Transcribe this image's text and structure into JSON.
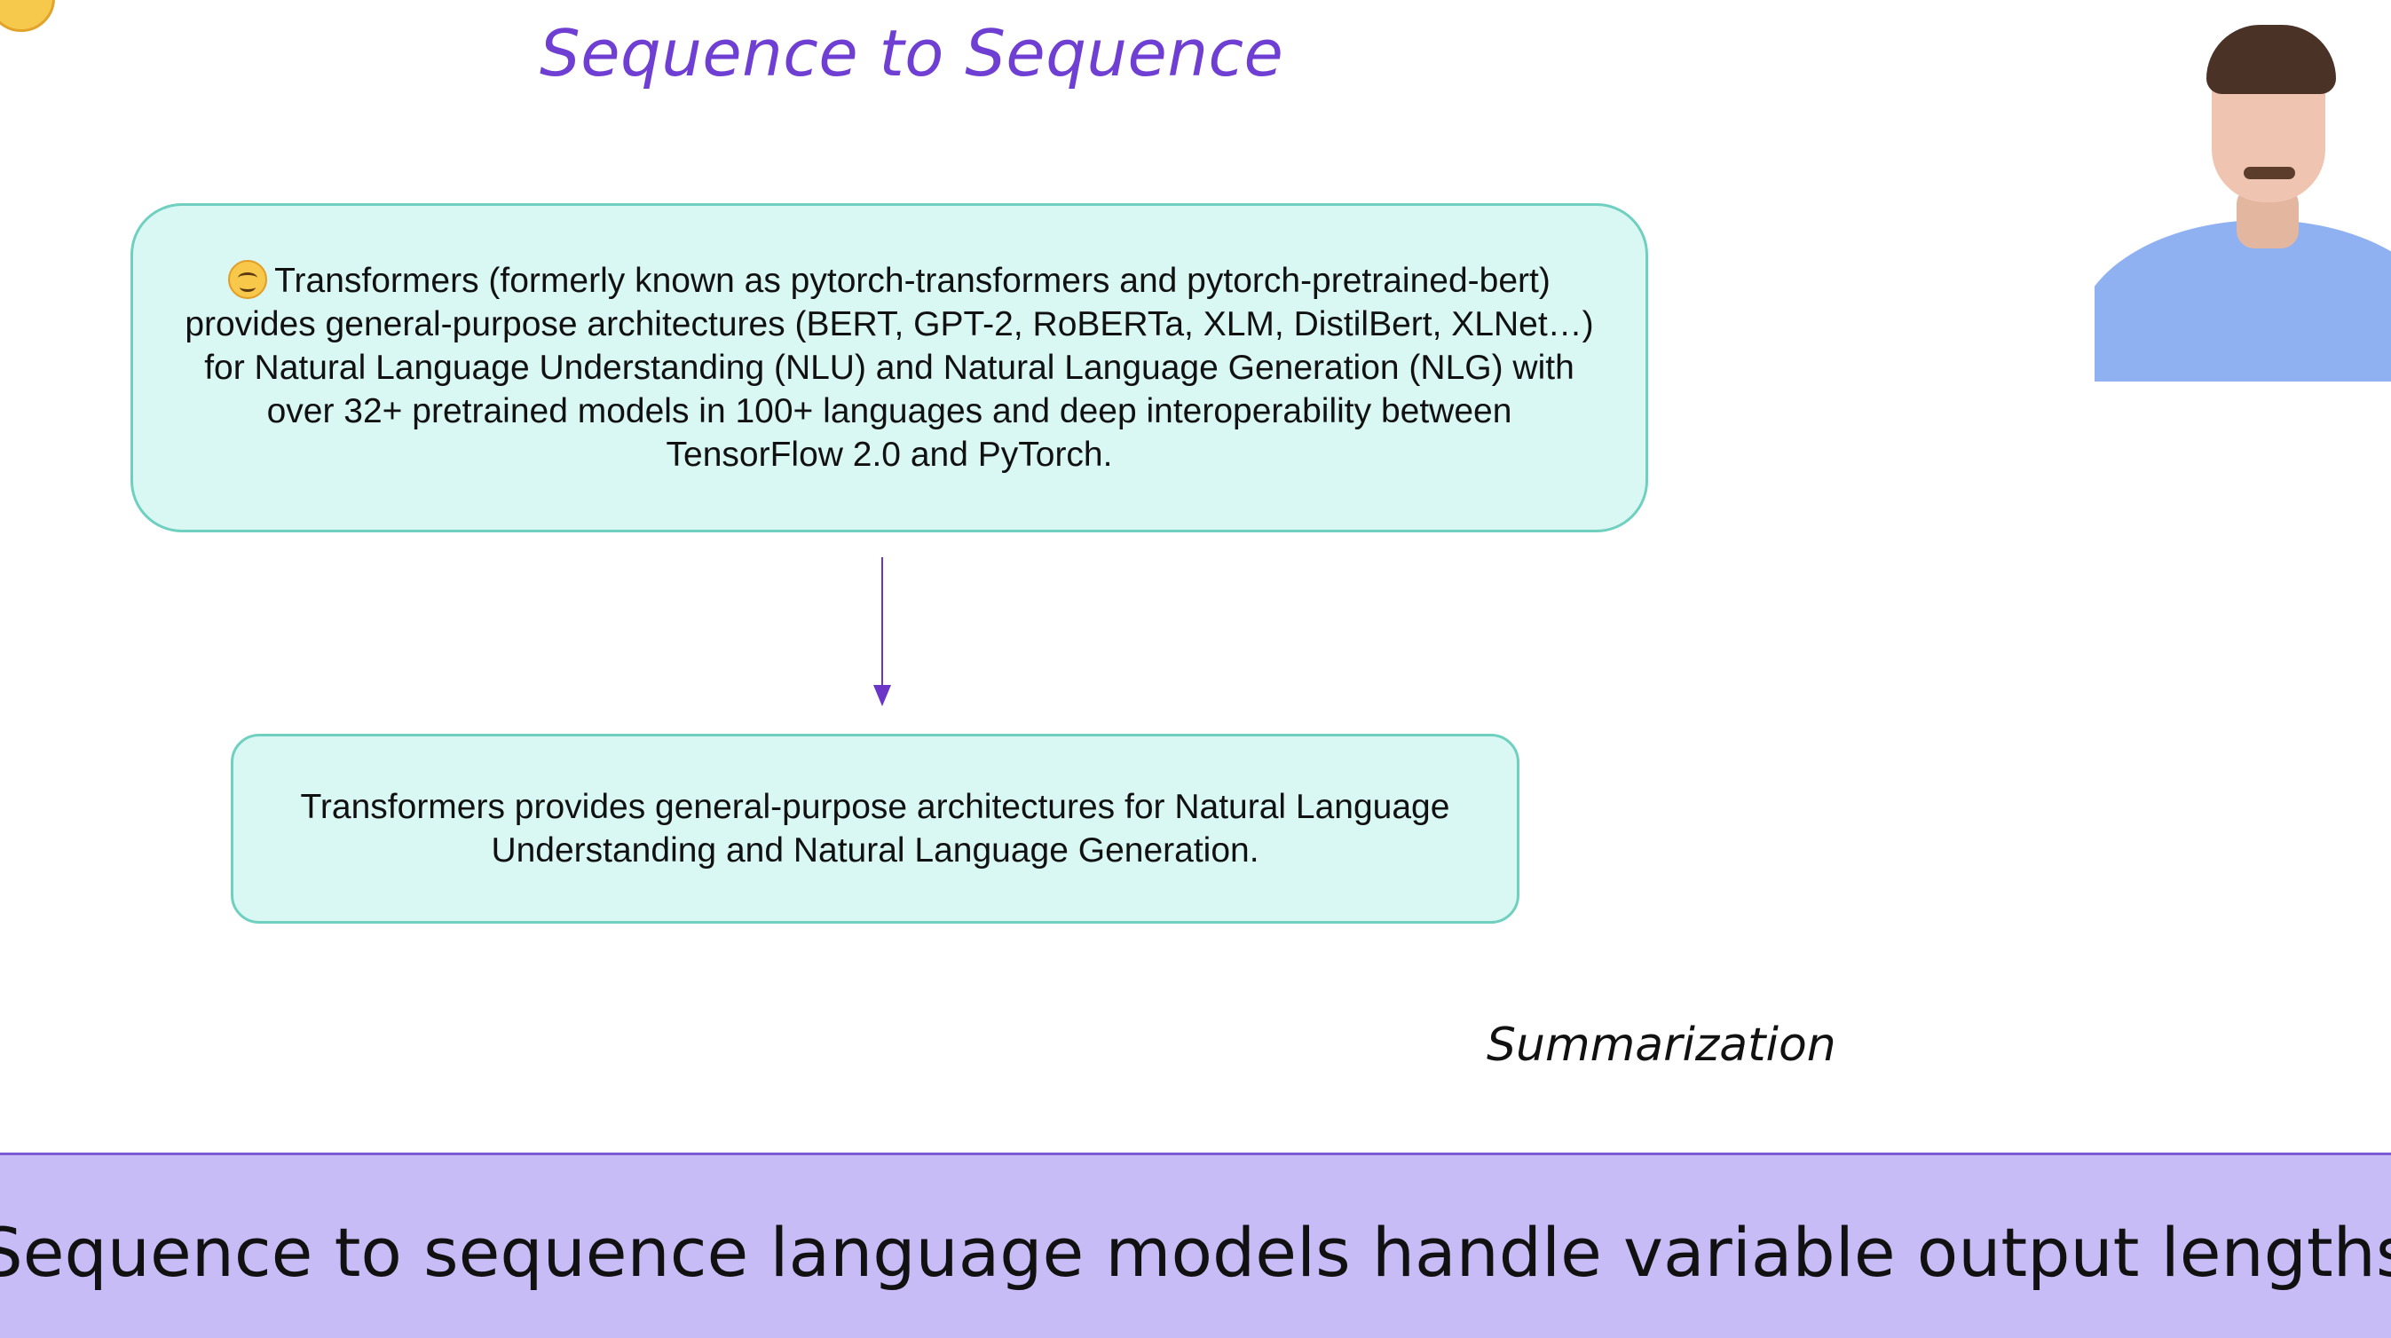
{
  "slide": {
    "title": "Sequence to Sequence",
    "input_text": "Transformers (formerly known as pytorch-transformers and pytorch-pretrained-bert) provides general-purpose architectures (BERT, GPT-2, RoBERTa, XLM, DistilBert, XLNet…) for Natural Language Understanding (NLU) and Natural Language Generation (NLG) with over 32+ pretrained models in 100+ languages and deep interoperability between TensorFlow 2.0 and PyTorch.",
    "output_text": "Transformers provides general-purpose architectures for Natural Language Understanding and Natural Language Generation.",
    "task_label": "Summarization"
  },
  "caption": {
    "text": "Sequence to sequence language models handle variable output lengths"
  },
  "icons": {
    "corner": "hugging-face-emoji-icon",
    "inline": "hugging-face-emoji-icon",
    "arrow": "down-arrow-icon"
  },
  "colors": {
    "title": "#6f3fd3",
    "box_fill": "#d9f7f3",
    "box_border": "#6fd0c0",
    "arrow": "#6b35c7",
    "caption_bar": "#c8bcf6"
  }
}
